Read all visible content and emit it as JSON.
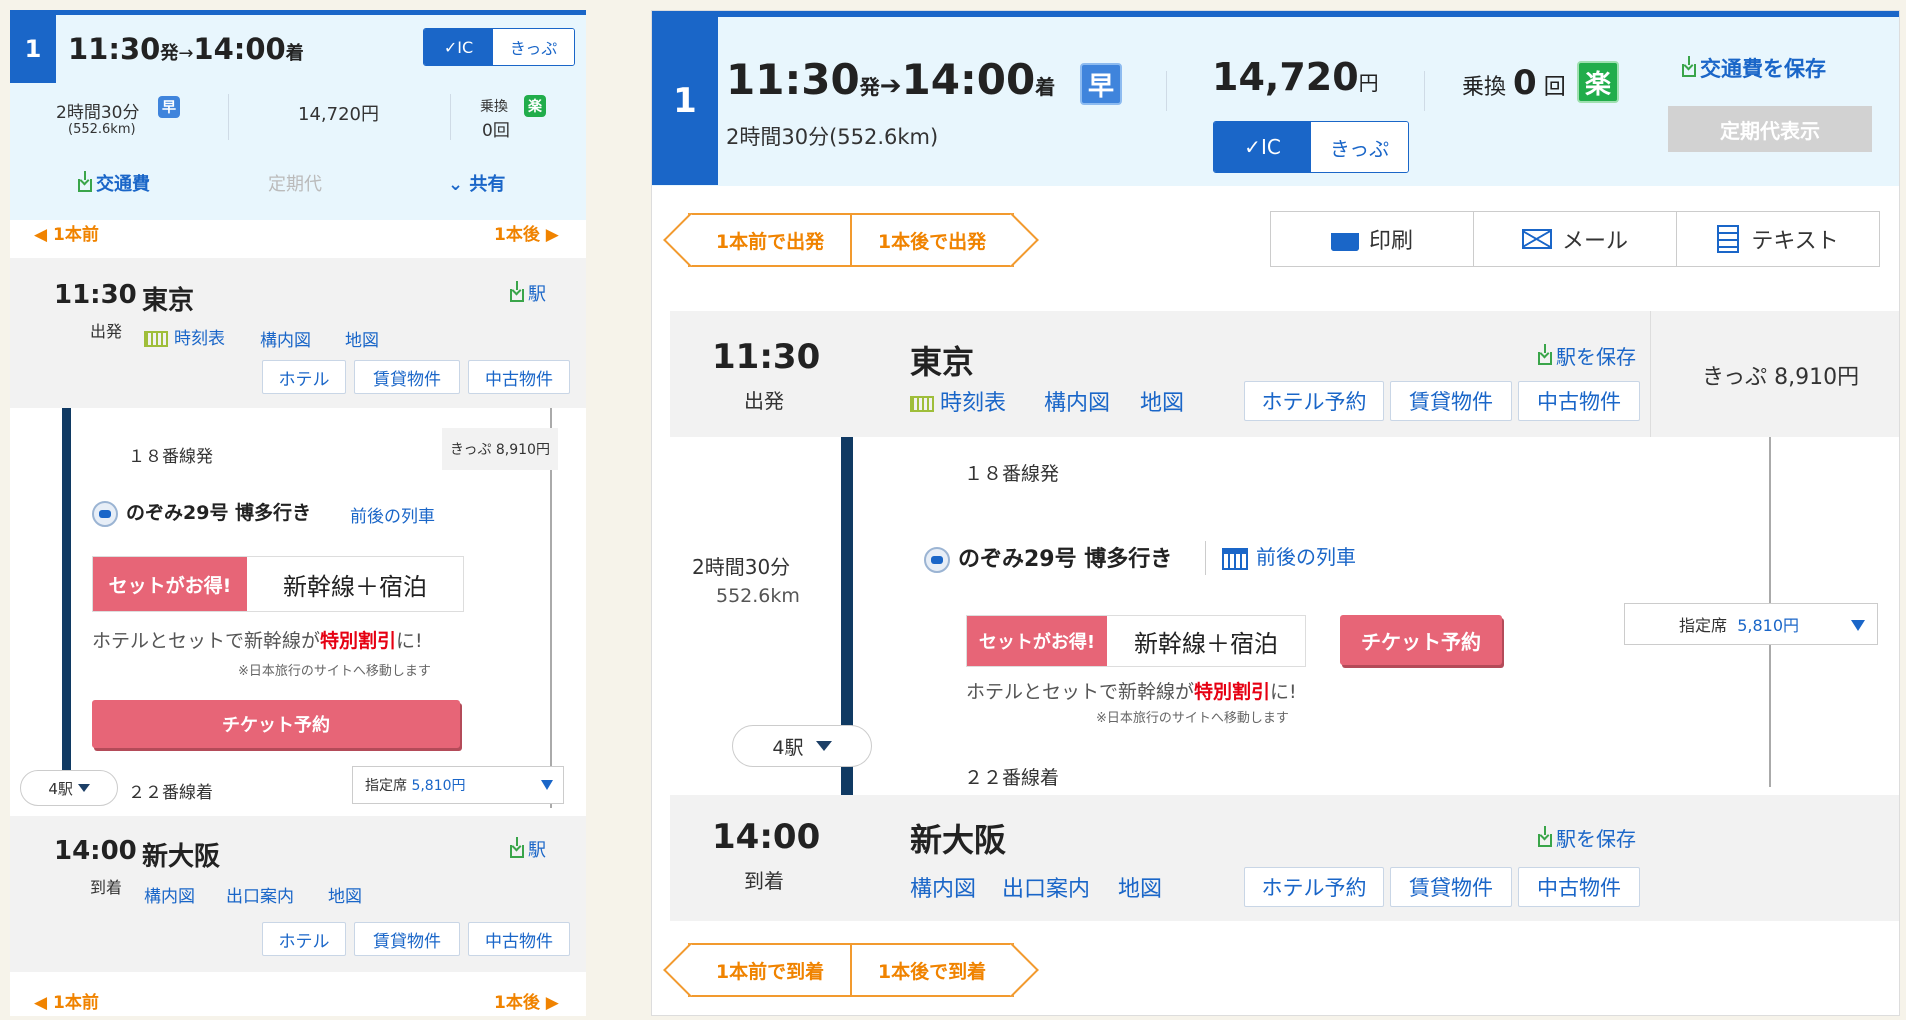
{
  "route": {
    "number": "1",
    "dep_time": "11:30",
    "dep_suffix": "発",
    "arrow": "→",
    "arr_time": "14:00",
    "arr_suffix": "着",
    "duration": "2時間30分",
    "distance_paren": "(552.6km)",
    "duration_full": "2時間30分(552.6km)",
    "distance": "552.6km",
    "badge_early": "早",
    "badge_easy": "楽",
    "fare": "14,720円",
    "fare_num": "14,720",
    "yen": "円",
    "transfer_label": "乗換",
    "transfer_count": "0回",
    "transfer_num": "0",
    "transfer_unit": "回",
    "ic_label": "IC",
    "kippu_label": "きっぷ",
    "save_fare": "交通費を保存",
    "commuter_pass": "定期代表示"
  },
  "left_links": {
    "fare": "交通費",
    "commuter": "定期代",
    "share": "共有",
    "prev": "1本前",
    "next": "1本後",
    "station_save": "駅"
  },
  "nav": {
    "prev_depart": "1本前で出発",
    "next_depart": "1本後で出発",
    "prev_arrive": "1本前で到着",
    "next_arrive": "1本後で到着"
  },
  "actions": {
    "print": "印刷",
    "mail": "メール",
    "text": "テキスト"
  },
  "origin": {
    "time": "11:30",
    "name": "東京",
    "action": "出発",
    "links": [
      "時刻表",
      "構内図",
      "地図"
    ],
    "save": "駅を保存",
    "buttons_short": [
      "ホテル",
      "賃貸物件",
      "中古物件"
    ],
    "buttons_long": [
      "ホテル予約",
      "賃貸物件",
      "中古物件"
    ],
    "fare_kippu": "きっぷ 8,910円"
  },
  "segment": {
    "platform_dep": "１８番線発",
    "train": "のぞみ29号 博多行き",
    "adjacent": "前後の列車",
    "set_label": "セットがお得!",
    "set_value": "新幹線＋宿泊",
    "promo_prefix": "ホテルとセットで新幹線が",
    "promo_highlight": "特別割引",
    "promo_suffix": "に!",
    "promo_note": "※日本旅行のサイトへ移動します",
    "ticket": "チケット予約",
    "stops": "4駅",
    "platform_arr": "２２番線着",
    "seat_label": "指定席",
    "seat_price": "5,810円",
    "duration": "2時間30分",
    "distance": "552.6km"
  },
  "destination": {
    "time": "14:00",
    "name": "新大阪",
    "action": "到着",
    "links": [
      "構内図",
      "出口案内",
      "地図"
    ],
    "save": "駅を保存",
    "buttons_short": [
      "ホテル",
      "賃貸物件",
      "中古物件"
    ],
    "buttons_long": [
      "ホテル予約",
      "賃貸物件",
      "中古物件"
    ]
  },
  "colors": {
    "brand_blue": "#1a66c8",
    "header_bg": "#e8f6fd",
    "accent_orange": "#f08300",
    "ticket_pink": "#e76577",
    "easy_green": "#21ad4b",
    "dark_line": "#103a63"
  }
}
